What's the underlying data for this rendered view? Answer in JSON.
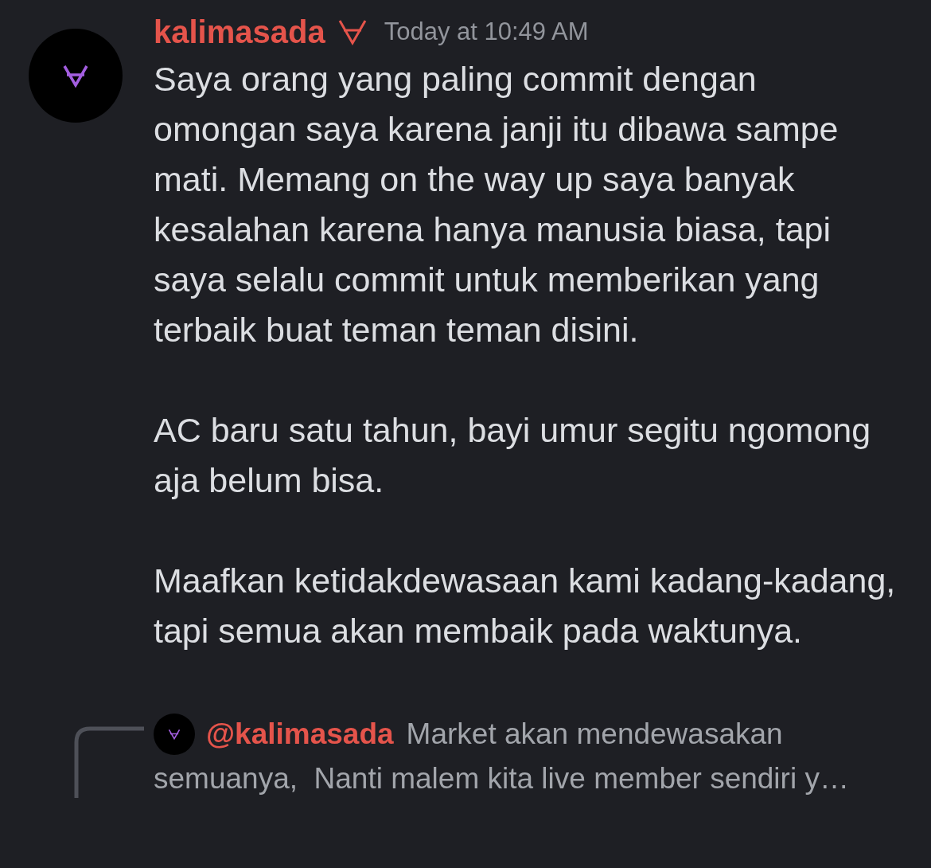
{
  "message": {
    "author": "kalimasada",
    "timestamp": "Today at 10:49 AM",
    "paragraphs": [
      "Saya orang yang paling commit dengan omongan saya karena janji itu dibawa sampe mati. Memang on the way up saya banyak kesalahan karena hanya manusia biasa, tapi saya selalu commit untuk memberikan yang terbaik buat teman teman disini.",
      "AC baru satu tahun, bayi umur segitu ngomong aja belum bisa.",
      "Maafkan ketidakdewasaan kami kadang-kadang, tapi semua akan membaik pada waktunya."
    ]
  },
  "reply": {
    "mention": "@kalimasada",
    "lines": [
      "Market akan mendewasakan",
      "semuanya,  Nanti malem kita live member sendiri y…"
    ]
  }
}
